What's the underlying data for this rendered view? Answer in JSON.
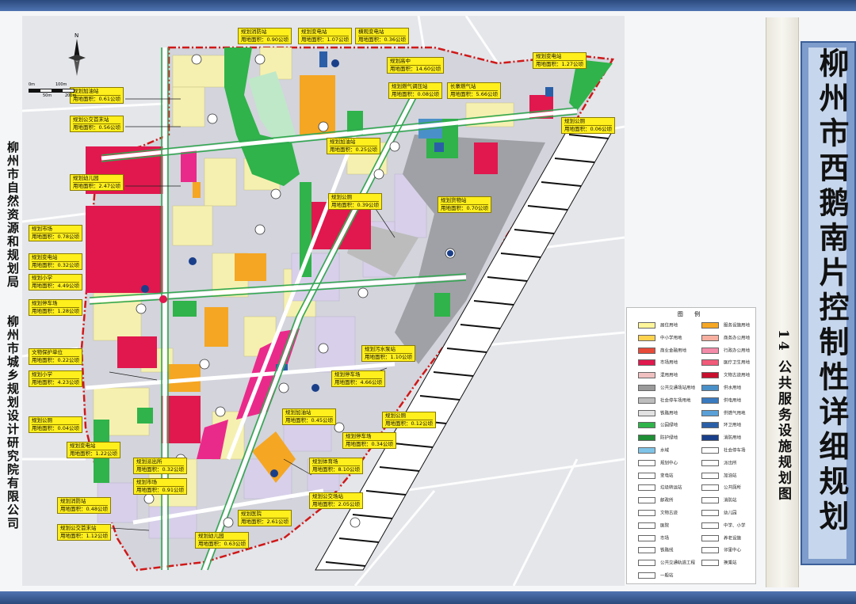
{
  "title": "柳州市西鹅南片控制性详细规划",
  "subtitle": "14 公共服务设施规划图",
  "agency_line1": "柳州市自然资源和规划局",
  "agency_line2": "柳州市城乡规划设计研究院有限公司",
  "compass_label": "N",
  "scale_labels": [
    "0m",
    "50m",
    "100m",
    "200m"
  ],
  "callouts": [
    {
      "name": "规划消防站",
      "area": "用地面积：0.90公顷"
    },
    {
      "name": "规划变电站",
      "area": "用地面积：1.07公顷"
    },
    {
      "name": "横观变电站",
      "area": "用地面积：0.36公顷"
    },
    {
      "name": "规划变电站",
      "area": "用地面积：1.27公顷"
    },
    {
      "name": "规划高中",
      "area": "用地面积：14.60公顷"
    },
    {
      "name": "规划加油站",
      "area": "用地面积：0.61公顷"
    },
    {
      "name": "规划燃气调压站",
      "area": "用地面积：0.08公顷"
    },
    {
      "name": "长寨燃气站",
      "area": "用地面积：5.66公顷"
    },
    {
      "name": "规划公交首末站",
      "area": "用地面积：0.56公顷"
    },
    {
      "name": "规划公厕",
      "area": "用地面积：0.06公顷"
    },
    {
      "name": "规划加油站",
      "area": "用地面积：0.25公顷"
    },
    {
      "name": "规划幼儿园",
      "area": "用地面积：2.47公顷"
    },
    {
      "name": "规划公厕",
      "area": "用地面积：0.39公顷"
    },
    {
      "name": "规划货物站",
      "area": "用地面积：0.70公顷"
    },
    {
      "name": "规划市场",
      "area": "用地面积：0.78公顷"
    },
    {
      "name": "规划变电站",
      "area": "用地面积：0.32公顷"
    },
    {
      "name": "规划小学",
      "area": "用地面积：4.49公顷"
    },
    {
      "name": "规划停车场",
      "area": "用地面积：1.28公顷"
    },
    {
      "name": "文物保护单位",
      "area": "用地面积：0.22公顷"
    },
    {
      "name": "规划污水泵站",
      "area": "用地面积：1.10公顷"
    },
    {
      "name": "规划小学",
      "area": "用地面积：4.23公顷"
    },
    {
      "name": "规划停车场",
      "area": "用地面积：4.66公顷"
    },
    {
      "name": "规划公厕",
      "area": "用地面积：0.04公顷"
    },
    {
      "name": "规划加油站",
      "area": "用地面积：0.45公顷"
    },
    {
      "name": "规划公厕",
      "area": "用地面积：0.12公顷"
    },
    {
      "name": "规划停车场",
      "area": "用地面积：0.34公顷"
    },
    {
      "name": "规划变电站",
      "area": "用地面积：1.22公顷"
    },
    {
      "name": "规划派出所",
      "area": "用地面积：0.32公顷"
    },
    {
      "name": "规划市场",
      "area": "用地面积：0.91公顷"
    },
    {
      "name": "规划体育场",
      "area": "用地面积：8.10公顷"
    },
    {
      "name": "规划消防站",
      "area": "用地面积：0.48公顷"
    },
    {
      "name": "规划公交首末站",
      "area": "用地面积：1.12公顷"
    },
    {
      "name": "规划公交场站",
      "area": "用地面积：2.05公顷"
    },
    {
      "name": "规划医院",
      "area": "用地面积：2.61公顷"
    },
    {
      "name": "规划幼儿园",
      "area": "用地面积：0.63公顷"
    }
  ],
  "legend": {
    "title": "图 例",
    "items": [
      {
        "label": "居住用地",
        "color": "#fff59a"
      },
      {
        "label": "服务设施用地",
        "color": "#f5a623"
      },
      {
        "label": "中小学用地",
        "color": "#ffd24d"
      },
      {
        "label": "商务办公用地",
        "color": "#f7b0a0"
      },
      {
        "label": "商业金融用地",
        "color": "#e84a3a"
      },
      {
        "label": "行政办公用地",
        "color": "#f48ba8"
      },
      {
        "label": "市场用地",
        "color": "#e0184e"
      },
      {
        "label": "医疗卫生用地",
        "color": "#f25a7a"
      },
      {
        "label": "混用用地",
        "color": "#f0c0c0"
      },
      {
        "label": "文物古迹用地",
        "color": "#c8102e"
      },
      {
        "label": "公共交通场站用地",
        "color": "#9a9a9a"
      },
      {
        "label": "供水用地",
        "color": "#4a90c8"
      },
      {
        "label": "社会停车场用地",
        "color": "#bdbdbd"
      },
      {
        "label": "供电用地",
        "color": "#3a7abf"
      },
      {
        "label": "铁路用地",
        "color": "#e2e2e2"
      },
      {
        "label": "供燃气用地",
        "color": "#5aa0d8"
      },
      {
        "label": "公园绿地",
        "color": "#2fb34a"
      },
      {
        "label": "环卫用地",
        "color": "#2a5fa8"
      },
      {
        "label": "防护绿地",
        "color": "#1f8f35"
      },
      {
        "label": "消防用地",
        "color": "#1a3f8a"
      },
      {
        "label": "水域",
        "color": "#7fc4e8"
      },
      {
        "label": "社会停车场",
        "color": "#ffffff"
      },
      {
        "label": "规划中心",
        "color": "#ffffff"
      },
      {
        "label": "派出所",
        "color": "#ffffff"
      },
      {
        "label": "变电站",
        "color": "#ffffff"
      },
      {
        "label": "加油站",
        "color": "#ffffff"
      },
      {
        "label": "垃圾转运站",
        "color": "#ffffff"
      },
      {
        "label": "公共厕所",
        "color": "#ffffff"
      },
      {
        "label": "邮政所",
        "color": "#ffffff"
      },
      {
        "label": "消防站",
        "color": "#ffffff"
      },
      {
        "label": "文物古迹",
        "color": "#ffffff"
      },
      {
        "label": "幼儿园",
        "color": "#ffffff"
      },
      {
        "label": "医院",
        "color": "#ffffff"
      },
      {
        "label": "中学、小学",
        "color": "#ffffff"
      },
      {
        "label": "市场",
        "color": "#ffffff"
      },
      {
        "label": "养老设施",
        "color": "#ffffff"
      },
      {
        "label": "铁路线",
        "color": "#ffffff"
      },
      {
        "label": "邻里中心",
        "color": "#ffffff"
      },
      {
        "label": "公共交通轨道工程",
        "color": "#ffffff"
      },
      {
        "label": "换乘站",
        "color": "#ffffff"
      },
      {
        "label": "一般站",
        "color": "#ffffff"
      }
    ]
  }
}
